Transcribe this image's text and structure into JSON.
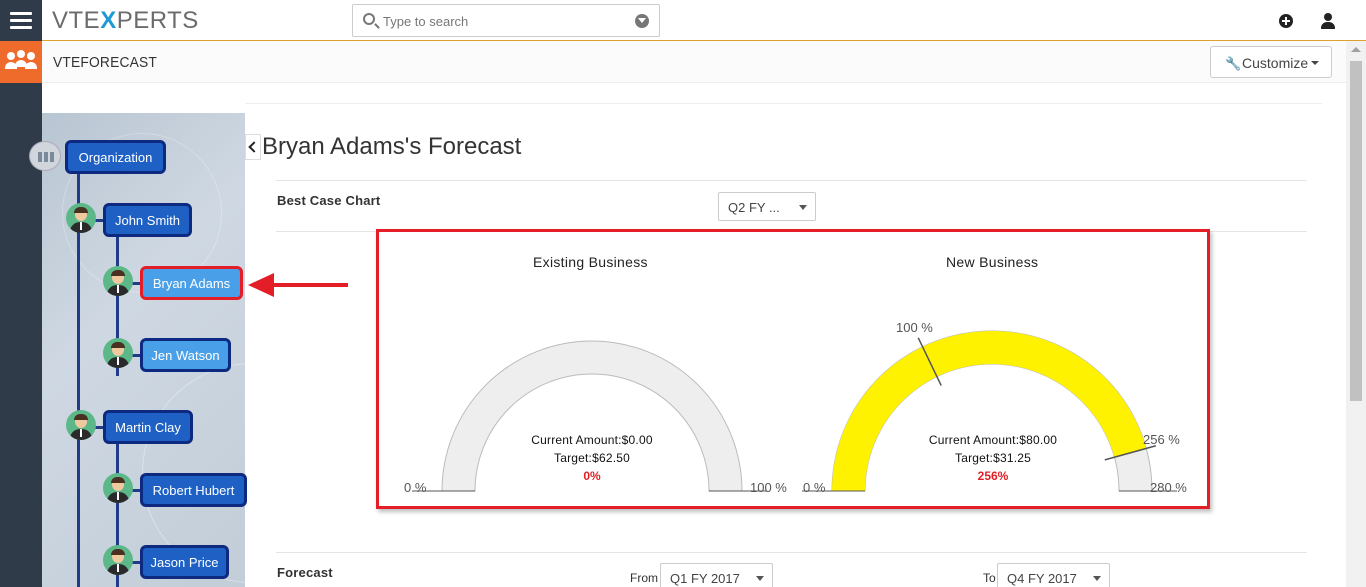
{
  "app": {
    "logo_prefix": "VTE",
    "logo_x": "X",
    "logo_suffix": "PERTS",
    "search_placeholder": "Type to search",
    "module_title": "VTEFORECAST",
    "customize_label": "Customize"
  },
  "org_tree": {
    "root": "Organization",
    "nodes": [
      {
        "label": "John Smith",
        "level": 1
      },
      {
        "label": "Bryan Adams",
        "level": 2,
        "selected": true
      },
      {
        "label": "Jen Watson",
        "level": 2
      },
      {
        "label": "Martin Clay",
        "level": 1
      },
      {
        "label": "Robert Hubert",
        "level": 2
      },
      {
        "label": "Jason Price",
        "level": 2
      }
    ]
  },
  "main": {
    "page_title": "Bryan Adams's Forecast",
    "best_case_label": "Best Case Chart",
    "quarter_select": "Q2 FY ...",
    "forecast_label": "Forecast",
    "from_label": "From",
    "from_value": "Q1 FY 2017",
    "to_label": "To",
    "to_value": "Q4 FY 2017"
  },
  "chart_data": [
    {
      "type": "gauge",
      "title": "Existing Business",
      "current_amount": "Current Amount:$0.00",
      "target": "Target:$62.50",
      "percent_label": "0%",
      "value": 0,
      "min_label": "0 %",
      "max_label": "100 %",
      "range": [
        0,
        100
      ],
      "fill_color": "#eeeeee"
    },
    {
      "type": "gauge",
      "title": "New Business",
      "current_amount": "Current Amount:$80.00",
      "target": "Target:$31.25",
      "percent_label": "256%",
      "value": 256,
      "min_label": "0 %",
      "max_label": "280 %",
      "target_label": "100 %",
      "value_label": "256 %",
      "range": [
        0,
        280
      ],
      "fill_color": "#fff200"
    }
  ]
}
